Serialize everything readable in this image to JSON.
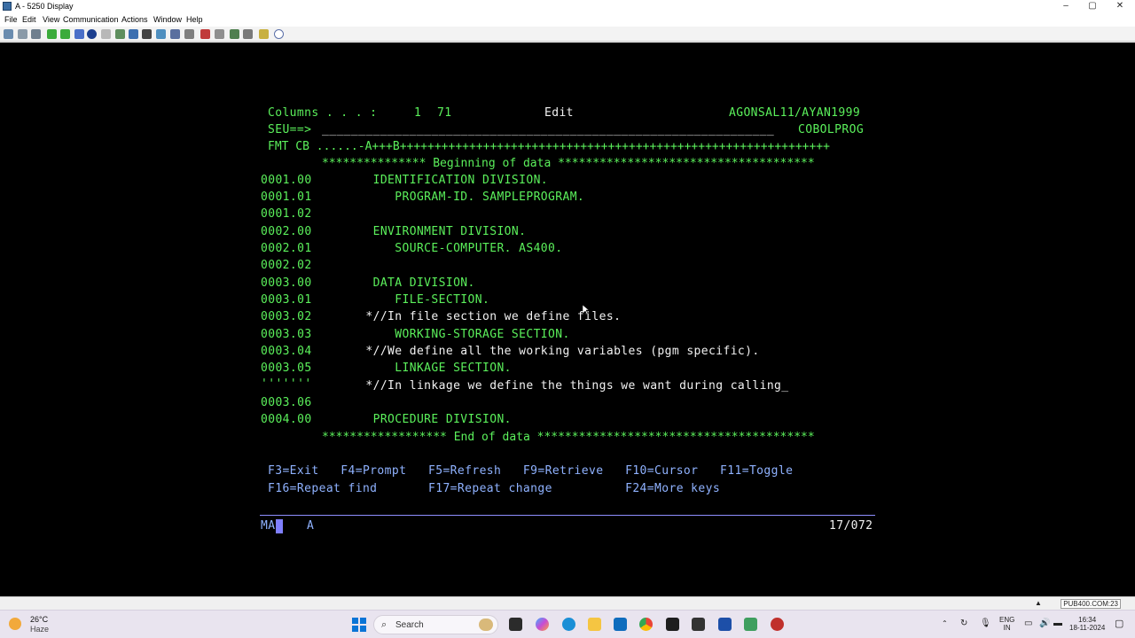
{
  "window": {
    "title": "A - 5250 Display",
    "minimize": "–",
    "maximize": "▢",
    "close": "✕"
  },
  "menu": [
    "File",
    "Edit",
    "View",
    "Communication",
    "Actions",
    "Window",
    "Help"
  ],
  "toolbar": {
    "icons": [
      "copy",
      "paste",
      "print",
      "send",
      "receive",
      "record",
      "playback",
      "macro",
      "options",
      "color",
      "keyboard",
      "mouse",
      "popup",
      "hotspots",
      "trace",
      "status",
      "log",
      "notes",
      "help"
    ]
  },
  "screen": {
    "header": {
      "columns_label": "Columns . . . :",
      "columns_from": "1",
      "columns_to": "71",
      "mode": "Edit",
      "library_member": "AGONSAL11/AYAN1999",
      "seu_prompt": "SEU==>",
      "seu_input": "______________________________________________________________",
      "source_member": "COBOLPROG",
      "fmt_line": "FMT CB ......-A+++B++++++++++++++++++++++++++++++++++++++++++++++++++++++++++++++"
    },
    "begin_marker": "*************** Beginning of data *************************************",
    "lines": [
      {
        "seq": "0001.00",
        "text": "       IDENTIFICATION DIVISION.",
        "color": "green"
      },
      {
        "seq": "0001.01",
        "text": "          PROGRAM-ID. SAMPLEPROGRAM.",
        "color": "green"
      },
      {
        "seq": "0001.02",
        "text": "",
        "color": "green"
      },
      {
        "seq": "0002.00",
        "text": "       ENVIRONMENT DIVISION.",
        "color": "green"
      },
      {
        "seq": "0002.01",
        "text": "          SOURCE-COMPUTER. AS400.",
        "color": "green"
      },
      {
        "seq": "0002.02",
        "text": "",
        "color": "green"
      },
      {
        "seq": "0003.00",
        "text": "       DATA DIVISION.",
        "color": "green"
      },
      {
        "seq": "0003.01",
        "text": "          FILE-SECTION.",
        "color": "green"
      },
      {
        "seq": "0003.02",
        "text": "      *//In file section we define files.",
        "color": "white"
      },
      {
        "seq": "0003.03",
        "text": "          WORKING-STORAGE SECTION.",
        "color": "green"
      },
      {
        "seq": "0003.04",
        "text": "      *//We define all the working variables (pgm specific).",
        "color": "white"
      },
      {
        "seq": "0003.05",
        "text": "          LINKAGE SECTION.",
        "color": "green"
      },
      {
        "seq": "'''''''",
        "text": "      *//In linkage we define the things we want during calling_",
        "color": "white"
      },
      {
        "seq": "0003.06",
        "text": "",
        "color": "green"
      },
      {
        "seq": "0004.00",
        "text": "       PROCEDURE DIVISION.",
        "color": "green"
      }
    ],
    "end_marker": "****************** End of data ****************************************",
    "fkeys_row1": "F3=Exit   F4=Prompt   F5=Refresh   F9=Retrieve   F10=Cursor   F11=Toggle",
    "fkeys_row2": "F16=Repeat find       F17=Repeat change          F24=More keys",
    "oia": {
      "left": "MA",
      "indicator": "A",
      "position": "17/072"
    }
  },
  "statusbar": {
    "session": "PUB400.COM:23"
  },
  "taskbar": {
    "temp": "26°C",
    "condition": "Haze",
    "search_label": "Search",
    "lang": "ENG",
    "region": "IN",
    "time": "16:34",
    "date": "18-11-2024"
  }
}
